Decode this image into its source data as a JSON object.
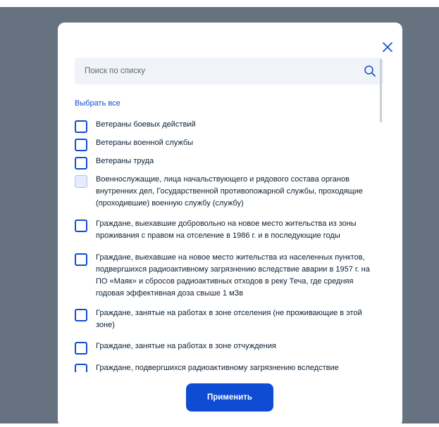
{
  "modal": {
    "search": {
      "placeholder": "Поиск по списку"
    },
    "select_all": "Выбрать все",
    "items": [
      {
        "label": "Ветераны боевых действий",
        "checked": false,
        "disabled": false
      },
      {
        "label": "Ветераны военной службы",
        "checked": false,
        "disabled": false
      },
      {
        "label": "Ветераны труда",
        "checked": false,
        "disabled": false
      },
      {
        "label": "Военнослужащие, лица начальствующего и рядового состава органов внутренних дел, Государственной противопожарной службы, проходящие (проходившие) военную службу (службу)",
        "checked": false,
        "disabled": true
      },
      {
        "label": "Граждане, выехавшие добровольно на новое место жительства из зоны проживания с правом на отселение в 1986 г. и в последующие годы",
        "checked": false,
        "disabled": false
      },
      {
        "label": "Граждане, выехавшие на новое место жительства из населенных пунктов, подвергшихся радиоактивному загрязнению вследствие аварии в 1957 г. на ПО «Маяк» и сбросов радиоактивных отходов в реку Теча, где средняя годовая эффективная доза свыше 1 мЗв",
        "checked": false,
        "disabled": false
      },
      {
        "label": "Граждане, занятые на работах в зоне отселения (не проживающие в этой зоне)",
        "checked": false,
        "disabled": false
      },
      {
        "label": "Граждане, занятые на работах в зоне отчуждения",
        "checked": false,
        "disabled": false
      },
      {
        "label": "Граждане, подвергшихся радиоактивному загрязнению вследствие",
        "checked": false,
        "disabled": false
      }
    ],
    "apply_label": "Применить"
  },
  "colors": {
    "accent": "#0d4cd3",
    "backdrop": "#66727f",
    "text": "#0b1f33"
  },
  "icons": {
    "close": "close-icon",
    "search": "search-icon",
    "checkbox": "checkbox-icon"
  }
}
